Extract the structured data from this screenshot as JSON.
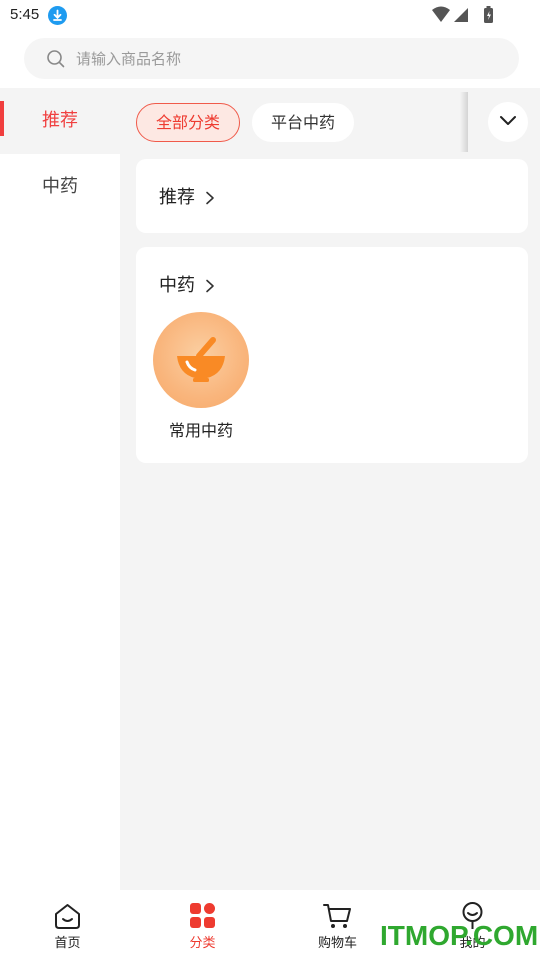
{
  "status_bar": {
    "time": "5:45"
  },
  "search": {
    "placeholder": "请输入商品名称",
    "value": ""
  },
  "sidebar": {
    "items": [
      {
        "label": "推荐",
        "active": true
      },
      {
        "label": "中药",
        "active": false
      }
    ]
  },
  "filter_chips": [
    {
      "label": "全部分类",
      "active": true
    },
    {
      "label": "平台中药",
      "active": false
    }
  ],
  "sections": [
    {
      "title": "推荐",
      "items": []
    },
    {
      "title": "中药",
      "items": [
        {
          "label": "常用中药",
          "icon": "mortar-bowl-icon"
        }
      ]
    }
  ],
  "tabbar": {
    "items": [
      {
        "label": "首页",
        "icon": "home-icon",
        "active": false
      },
      {
        "label": "分类",
        "icon": "category-grid-icon",
        "active": true
      },
      {
        "label": "购物车",
        "icon": "cart-icon",
        "active": false
      },
      {
        "label": "我的",
        "icon": "profile-icon",
        "active": false
      }
    ]
  },
  "watermark": "ITMOP.COM",
  "colors": {
    "accent": "#ee3b30",
    "chip_active_bg": "#fde8e3",
    "page_bg": "#f4f4f4",
    "category_icon": "#f98a25"
  }
}
